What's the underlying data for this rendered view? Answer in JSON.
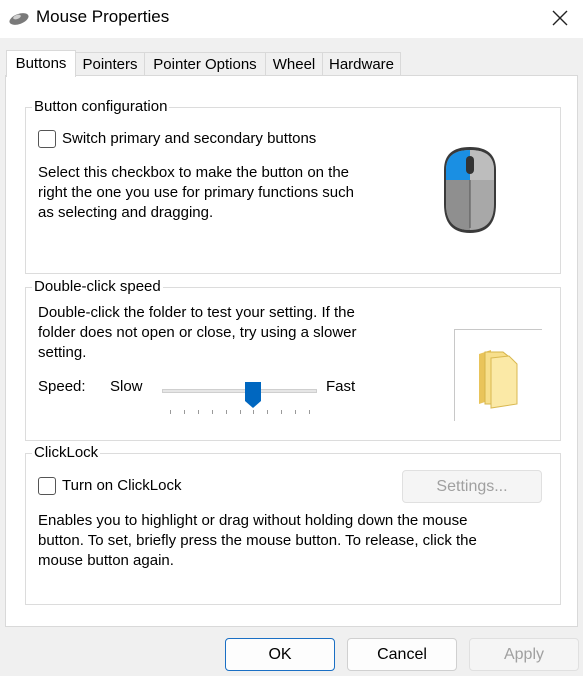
{
  "window": {
    "title": "Mouse Properties"
  },
  "tabs": [
    {
      "label": "Buttons",
      "active": true
    },
    {
      "label": "Pointers",
      "active": false
    },
    {
      "label": "Pointer Options",
      "active": false
    },
    {
      "label": "Wheel",
      "active": false
    },
    {
      "label": "Hardware",
      "active": false
    }
  ],
  "button_config": {
    "group_label": "Button configuration",
    "checkbox_label": "Switch primary and secondary buttons",
    "checked": false,
    "description_lines": [
      "Select this checkbox to make the button on the",
      "right the one you use for primary functions such",
      "as selecting and dragging."
    ]
  },
  "double_click": {
    "group_label": "Double-click speed",
    "description_lines": [
      "Double-click the folder to test your setting. If the",
      "folder does not open or close, try using a slower",
      "setting."
    ],
    "speed_label": "Speed:",
    "slow_label": "Slow",
    "fast_label": "Fast",
    "slider_value": 0.6
  },
  "clicklock": {
    "group_label": "ClickLock",
    "checkbox_label": "Turn on ClickLock",
    "checked": false,
    "settings_label": "Settings...",
    "description_lines": [
      "Enables you to highlight or drag without holding down the mouse",
      "button. To set, briefly press the mouse button. To release, click the",
      "mouse button again."
    ]
  },
  "footer": {
    "ok_label": "OK",
    "cancel_label": "Cancel",
    "apply_label": "Apply"
  },
  "colors": {
    "accent": "#0067c0",
    "mouse_highlight": "#1a8fe3"
  },
  "icons": {
    "title": "mouse-icon",
    "close": "close-icon",
    "preview": "mouse-preview-icon",
    "folder": "folder-icon"
  }
}
